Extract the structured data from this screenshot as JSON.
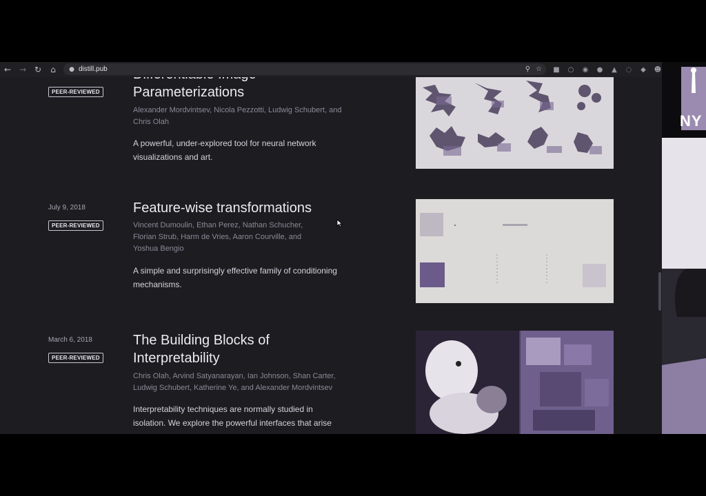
{
  "browser": {
    "url": "distill.pub",
    "back_icon": "arrow-left-icon",
    "forward_icon": "arrow-right-icon",
    "reload_icon": "reload-icon",
    "home_icon": "home-icon"
  },
  "articles": [
    {
      "date": "",
      "badge": "PEER-REVIEWED",
      "title_line1": "Differentiable Image",
      "title_line2": "Parameterizations",
      "authors_line1": "Alexander Mordvintsev, Nicola Pezzotti, Ludwig Schubert, and",
      "authors_line2": "Chris Olah",
      "desc_line1": "A powerful, under-explored tool for neural network",
      "desc_line2": "visualizations and art."
    },
    {
      "date": "July 9, 2018",
      "badge": "PEER-REVIEWED",
      "title_line1": "Feature-wise transformations",
      "authors_line1": "Vincent Dumoulin, Ethan Perez, Nathan Schucher,",
      "authors_line2": "Florian Strub, Harm de Vries, Aaron Courville, and",
      "authors_line3": "Yoshua Bengio",
      "desc_line1": "A simple and surprisingly effective family of conditioning",
      "desc_line2": "mechanisms."
    },
    {
      "date": "March 6, 2018",
      "badge": "PEER-REVIEWED",
      "title_line1": "The Building Blocks of",
      "title_line2": "Interpretability",
      "authors_line1": "Chris Olah, Arvind Satyanarayan, Ian Johnson, Shan Carter,",
      "authors_line2": "Ludwig Schubert, Katherine Ye, and Alexander Mordvintsev",
      "desc_line1": "Interpretability techniques are normally studied in",
      "desc_line2": "isolation. We explore the powerful interfaces that arise"
    }
  ],
  "video": {
    "logo_text": "NY"
  },
  "colors": {
    "page_bg": "#1d1c21",
    "text_primary": "#ecebf1",
    "text_muted": "#8b8996",
    "thumb_bg": "#dad7dc"
  }
}
